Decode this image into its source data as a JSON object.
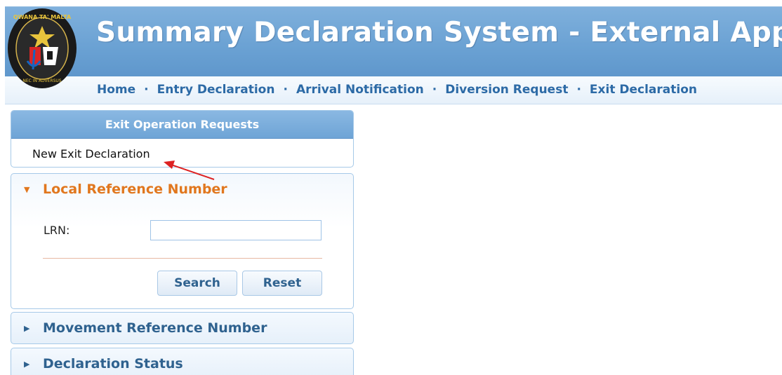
{
  "header": {
    "title": "Summary Declaration System - External App",
    "logo": {
      "ring_text_top": "QWANA TA' MALTA",
      "ring_text_bottom": "NEC IN ADVERSUS",
      "icon": "customs-emblem"
    },
    "colors": {
      "header_bg": "#6aa1d3",
      "nav_text": "#2c6aa6"
    }
  },
  "nav": {
    "items": [
      "Home",
      "Entry Declaration",
      "Arrival Notification",
      "Diversion Request",
      "Exit Declaration"
    ],
    "separator": "·"
  },
  "sidebar": {
    "exit_panel": {
      "title": "Exit Operation Requests",
      "link": "New Exit Declaration"
    },
    "lrn_panel": {
      "title": "Local Reference Number",
      "expanded": true,
      "label": "LRN:",
      "input_value": "",
      "search_label": "Search",
      "reset_label": "Reset"
    },
    "mrn_panel": {
      "title": "Movement Reference Number",
      "expanded": false
    },
    "status_panel": {
      "title": "Declaration Status",
      "expanded": false
    }
  },
  "annotation": {
    "color": "#dd2222",
    "icon": "red-pointer-arrow"
  }
}
